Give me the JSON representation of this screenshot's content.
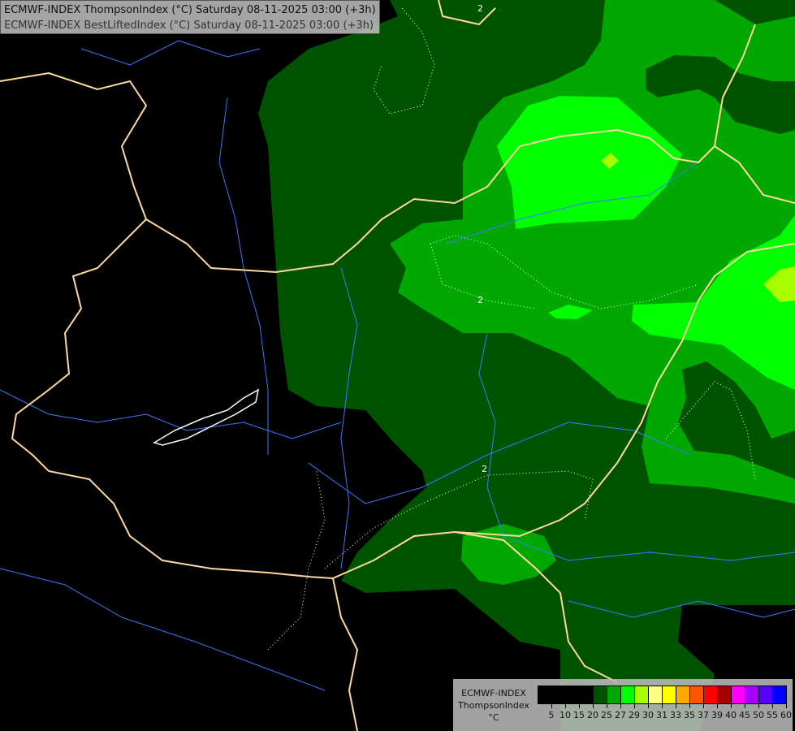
{
  "title": {
    "line1": "ECMWF-INDEX ThompsonIndex (°C) Saturday 08-11-2025 03:00 (+3h)",
    "line2": "ECMWF-INDEX BestLiftedIndex (°C) Saturday 08-11-2025 03:00 (+3h)"
  },
  "map": {
    "contour_labels": [
      "2",
      "2",
      "2"
    ],
    "colors": {
      "dark_green": "#005400",
      "mid_green": "#00a800",
      "bright_green": "#00ff00",
      "lime": "#a8ff00",
      "border": "#ffd8a0",
      "river": "#3c78ff"
    }
  },
  "legend": {
    "source": "ECMWF-INDEX",
    "parameter": "ThompsonIndex",
    "unit": "°C",
    "colors": [
      "#000000",
      "#000000",
      "#000000",
      "#000000",
      "#005400",
      "#00a800",
      "#00ff00",
      "#a8ff00",
      "#ffff80",
      "#ffff00",
      "#ffa800",
      "#ff5400",
      "#ff0000",
      "#a80000",
      "#ff00ff",
      "#a800ff",
      "#5400ff",
      "#0000ff"
    ],
    "ticks": [
      "5",
      "10",
      "15",
      "20",
      "25",
      "27",
      "29",
      "30",
      "31",
      "33",
      "35",
      "37",
      "39",
      "40",
      "45",
      "50",
      "55",
      "60"
    ]
  }
}
